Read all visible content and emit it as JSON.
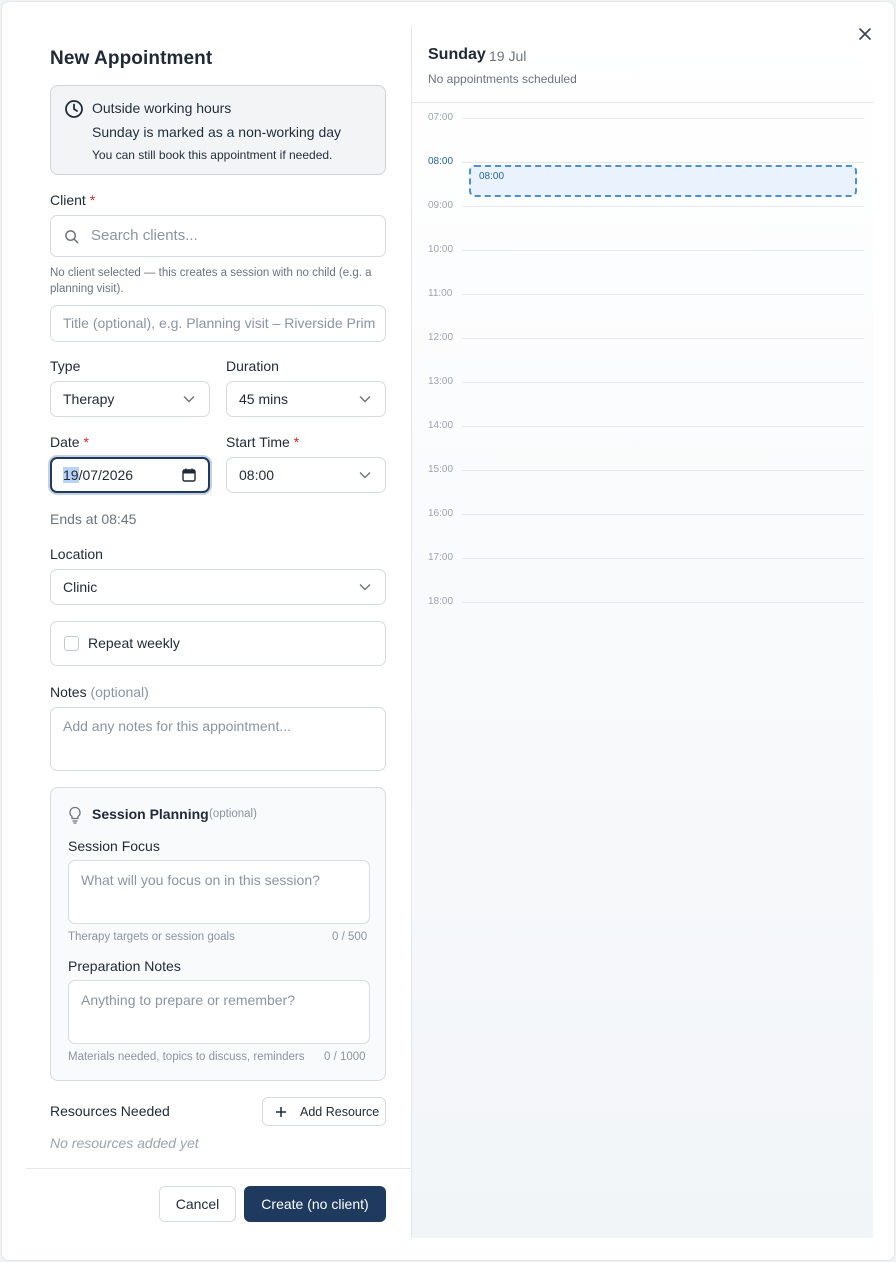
{
  "dialog": {
    "title": "New Appointment",
    "close_icon": "close-icon"
  },
  "warning": {
    "icon": "clock-icon",
    "title": "Outside working hours",
    "line1": "Sunday is marked as a non-working day",
    "line2": "You can still book this appointment if needed."
  },
  "client": {
    "label": "Client",
    "required_mark": "*",
    "placeholder": "Search clients...",
    "hint": "No client selected — this creates a session with no child (e.g. a planning visit)."
  },
  "title_field": {
    "placeholder": "Title (optional), e.g. Planning visit – Riverside Prim"
  },
  "type": {
    "label": "Type",
    "value": "Therapy"
  },
  "duration": {
    "label": "Duration",
    "value": "45 mins"
  },
  "date": {
    "label": "Date",
    "required_mark": "*",
    "day": "19",
    "rest": "/07/2026"
  },
  "start_time": {
    "label": "Start Time",
    "required_mark": "*",
    "value": "08:00"
  },
  "ends_at": "Ends at 08:45",
  "location": {
    "label": "Location",
    "value": "Clinic"
  },
  "repeat": {
    "label": "Repeat weekly",
    "checked": false
  },
  "notes": {
    "label": "Notes",
    "optional": "(optional)",
    "placeholder": "Add any notes for this appointment..."
  },
  "session_planning": {
    "icon": "lightbulb-icon",
    "title": "Session Planning",
    "optional": "(optional)",
    "focus": {
      "label": "Session Focus",
      "placeholder": "What will you focus on in this session?",
      "hint": "Therapy targets or session goals",
      "counter": "0 / 500"
    },
    "prep": {
      "label": "Preparation Notes",
      "placeholder": "Anything to prepare or remember?",
      "hint": "Materials needed, topics to discuss, reminders",
      "counter": "0 / 1000"
    }
  },
  "resources": {
    "label": "Resources Needed",
    "add_button": "Add Resource",
    "empty": "No resources added yet"
  },
  "footer": {
    "cancel": "Cancel",
    "create": "Create (no client)"
  },
  "calendar": {
    "day": "Sunday",
    "date": "19 Jul",
    "subtitle": "No appointments scheduled",
    "hours": [
      "07:00",
      "08:00",
      "09:00",
      "10:00",
      "11:00",
      "12:00",
      "13:00",
      "14:00",
      "15:00",
      "16:00",
      "17:00",
      "18:00"
    ],
    "current_hour": "08:00",
    "slot_label": "08:00"
  },
  "colors": {
    "primary": "#1e3a5f",
    "accent_blue": "#3b82c4",
    "required": "#dc2626"
  }
}
